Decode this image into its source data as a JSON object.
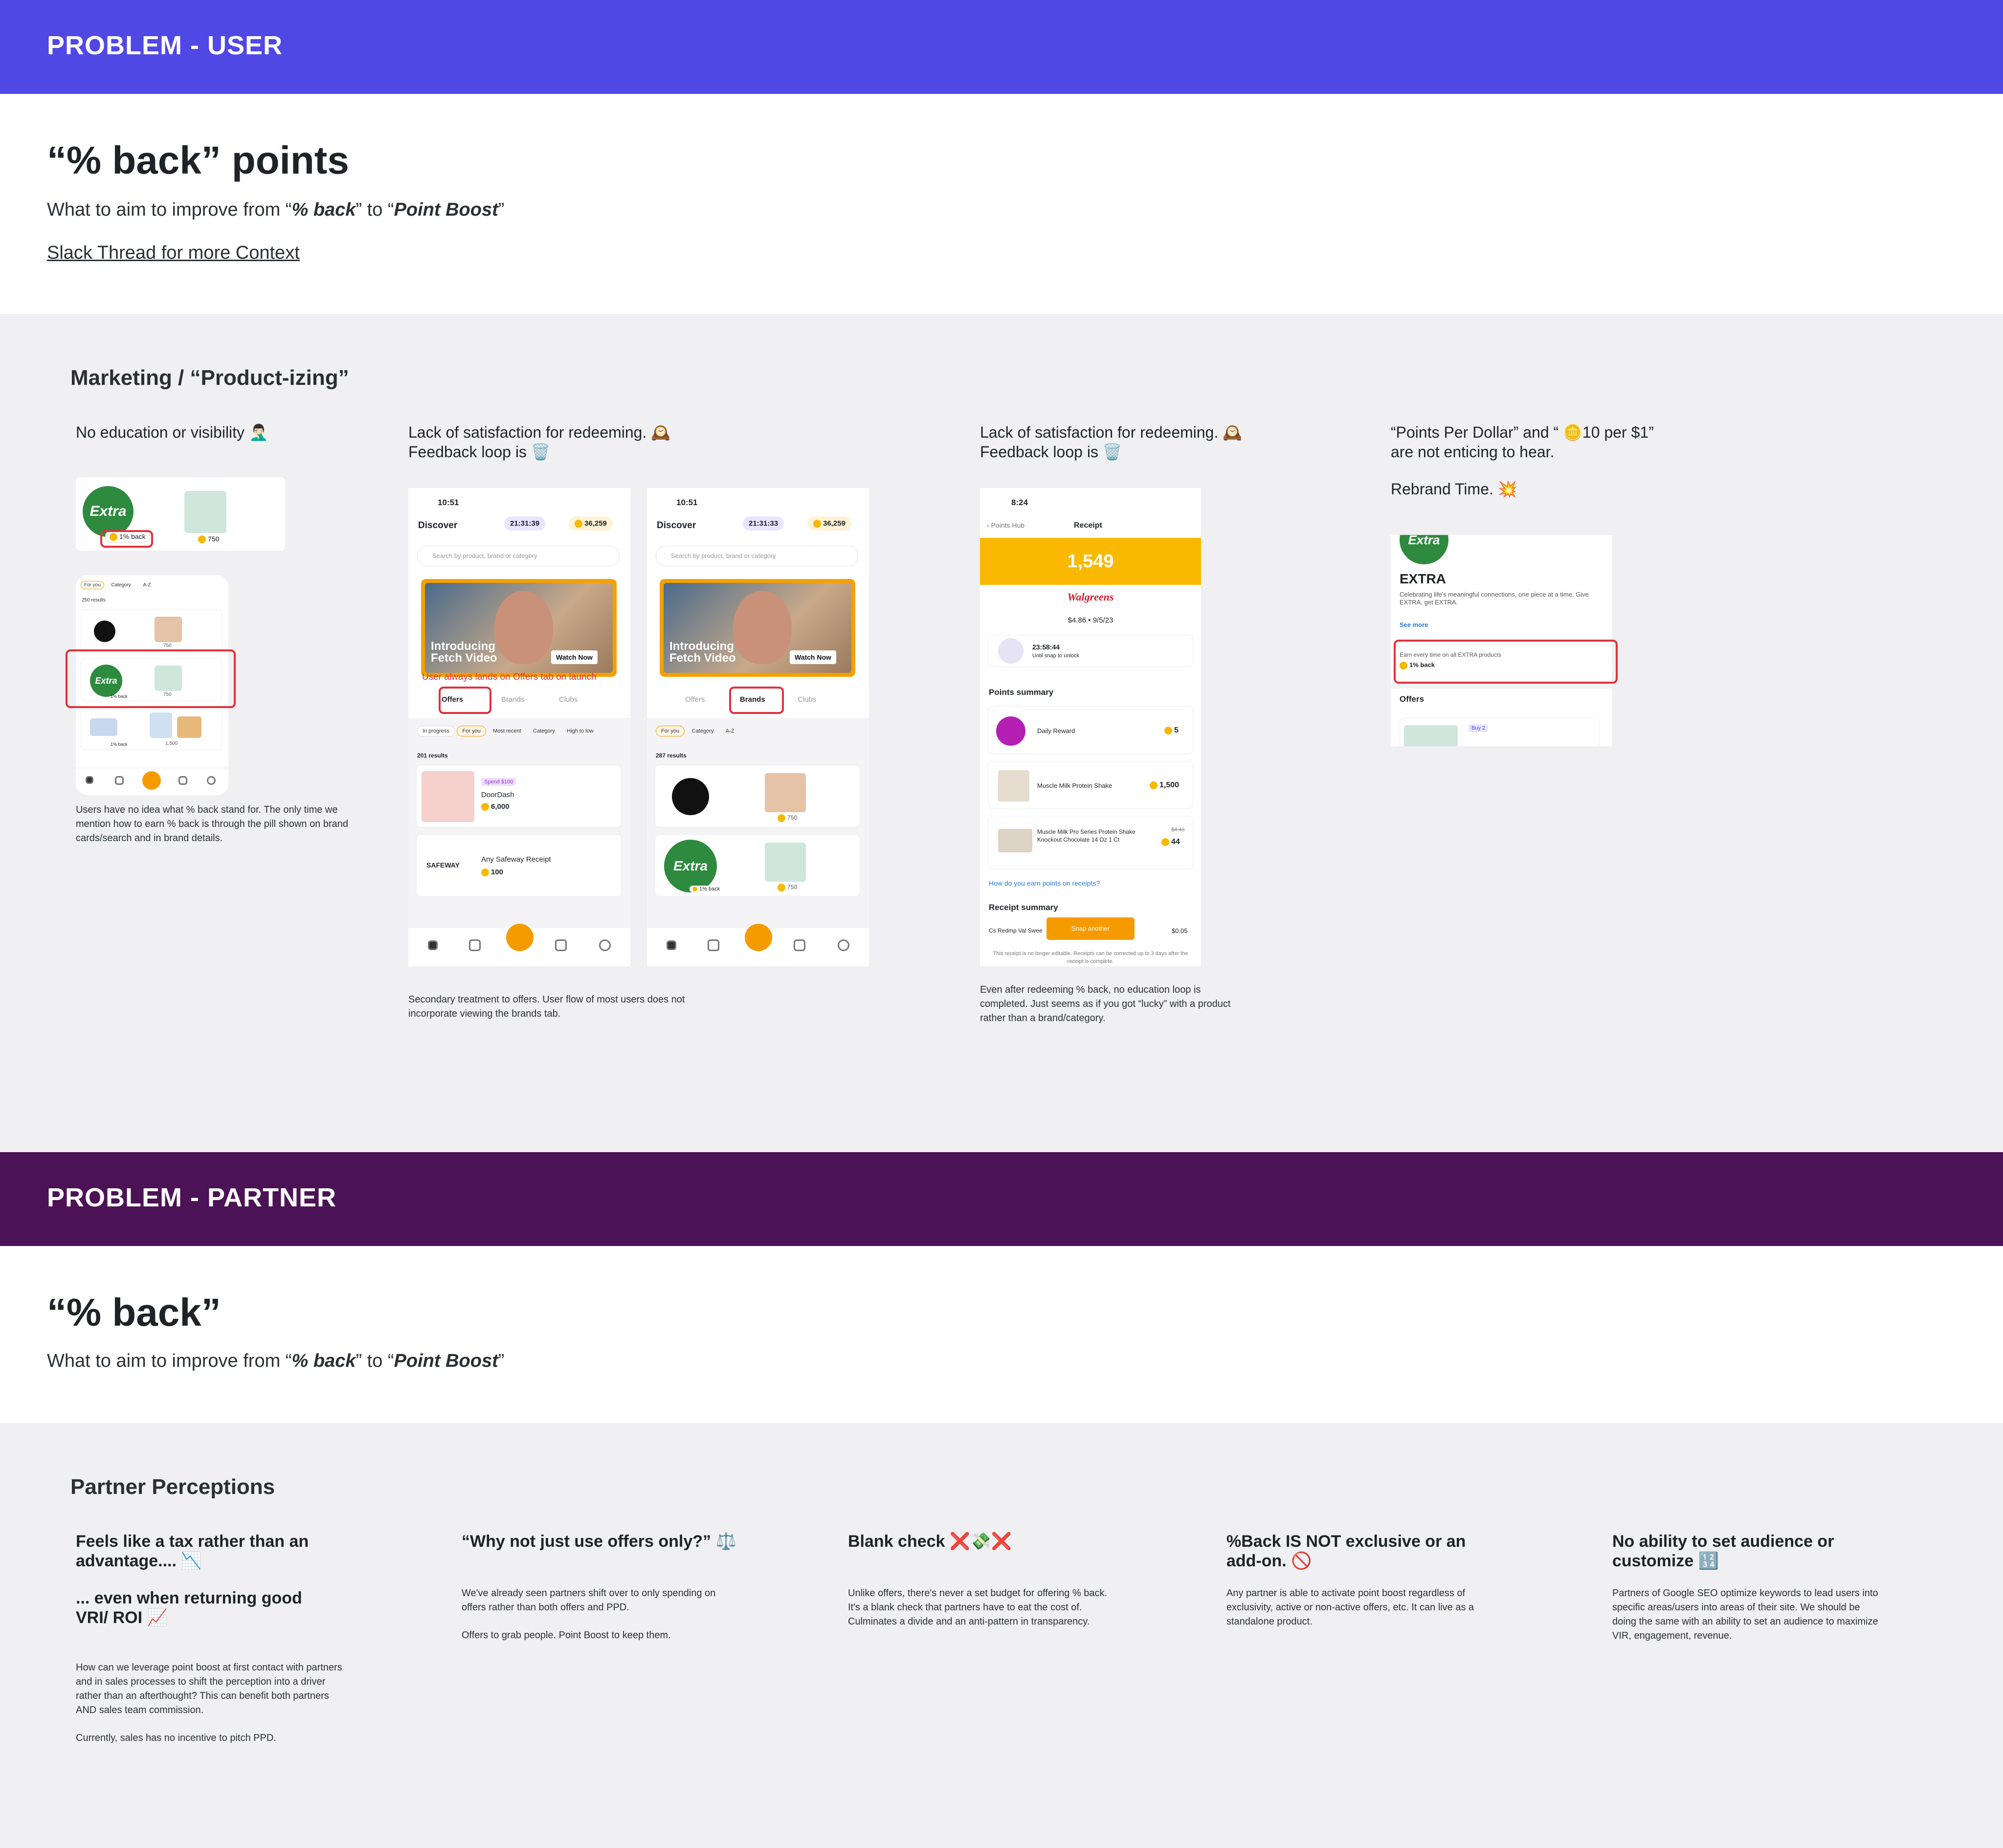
{
  "user_section": {
    "band_title": "PROBLEM - USER",
    "band_color": "#5048e5",
    "heading": "“% back” points",
    "subtitle_prefix": "What to aim to improve from “",
    "subtitle_em1": "% back",
    "subtitle_mid": "” to “",
    "subtitle_em2": "Point Boost",
    "subtitle_suffix": "”",
    "link": "Slack Thread for more Context"
  },
  "marketing": {
    "title": "Marketing / “Product-izing”",
    "col1": {
      "title": "No education or visibility 🤦🏻‍♂️",
      "note": "Users have no idea what % back stand for. The only time we mention how to earn % back is through the pill shown on brand cards/search and in brand details.",
      "card_pill": "1% back",
      "card_points": "750",
      "tabs": [
        "For you",
        "Category",
        "A-Z"
      ],
      "results": "250 results",
      "rows": [
        {
          "points": "750"
        },
        {
          "points": "750",
          "pill": "1% back"
        },
        {
          "points": "1,500",
          "pill": "1% back"
        }
      ]
    },
    "col2": {
      "title_line1": "Lack of satisfaction for redeeming. 🕰️",
      "title_line2": "Feedback loop is 🗑️",
      "note": "Secondary treatment to offers. User flow of most users does not incorporate viewing the brands tab.",
      "annotation": "User always lands on Offers tab on launch",
      "phone_a": {
        "time": "10:51",
        "title": "Discover",
        "timer": "21:31:39",
        "points": "36,259",
        "search_placeholder": "Search by product, brand or category",
        "video_title_1": "Introducing",
        "video_title_2": "Fetch Video",
        "watch": "Watch Now",
        "tabs": [
          "Offers",
          "Brands",
          "Clubs"
        ],
        "filters": [
          "In progress",
          "For you",
          "Most recent",
          "Category",
          "High to low"
        ],
        "results": "201 results",
        "offers": [
          {
            "badge": "Spend $100",
            "name": "DoorDash",
            "points": "6,000"
          },
          {
            "logo": "SAFEWAY",
            "name": "Any Safeway Receipt",
            "points": "100"
          }
        ]
      },
      "phone_b": {
        "time": "10:51",
        "title": "Discover",
        "timer": "21:31:33",
        "points": "36,259",
        "search_placeholder": "Search by product, brand or category",
        "video_title_1": "Introducing",
        "video_title_2": "Fetch Video",
        "watch": "Watch Now",
        "tabs": [
          "Offers",
          "Brands",
          "Clubs"
        ],
        "filters": [
          "For you",
          "Category",
          "A-Z"
        ],
        "results": "287 results",
        "rows": [
          {
            "points": "750"
          },
          {
            "points": "750",
            "pill": "1% back"
          }
        ]
      }
    },
    "col3": {
      "title_line1": "Lack of satisfaction for redeeming. 🕰️",
      "title_line2": "Feedback loop is 🗑️",
      "note": "Even after redeeming % back, no education loop is completed. Just seems as if you got “lucky” with a product rather than a brand/category.",
      "phone": {
        "time": "8:24",
        "back": "Points Hub",
        "title": "Receipt",
        "points": "1,549",
        "store": "Walgreens",
        "meta": "$4.86 • 9/5/23",
        "timer": "23:58:44",
        "timer_sub": "Until snap to unlock",
        "summary_title": "Points summary",
        "items": [
          {
            "name": "Daily Reward",
            "points": "5"
          },
          {
            "name": "Muscle Milk Protein Shake",
            "points": "1,500"
          },
          {
            "name": "Muscle Milk Pro Series Protein Shake Knockout Chocolate 14 Oz 1 Ct",
            "strike": "$4.43",
            "points": "44"
          }
        ],
        "how_link": "How do you earn points on receipts?",
        "receipt_title": "Receipt summary",
        "receipt_line": "Cs Redmp Val Swee",
        "receipt_amount": "$0.05",
        "snap_button": "Snap another",
        "footer": "This receipt is no longer editable. Receipts can be corrected up to 3 days after the receipt is complete."
      }
    },
    "col4": {
      "title_line1": "“Points Per Dollar” and “ 🪙10 per $1”",
      "title_line2": "are not enticing to hear.",
      "title_line3": "Rebrand Time. 💥",
      "brand": {
        "name": "EXTRA",
        "desc": "Celebrating life's meaningful connections, one piece at a time. Give EXTRA, get EXTRA.",
        "see_more": "See more",
        "earn_text": "Earn every time on all EXTRA products",
        "earn_pill": "1% back",
        "offers_title": "Offers",
        "offer_badge": "Buy 2"
      }
    }
  },
  "partner_section": {
    "band_title": "PROBLEM - PARTNER",
    "band_color": "#4b1255",
    "heading": "“% back”",
    "subtitle_prefix": "What to aim to improve from “",
    "subtitle_em1": "% back",
    "subtitle_mid": "” to “",
    "subtitle_em2": "Point Boost",
    "subtitle_suffix": "”"
  },
  "perceptions": {
    "title": "Partner Perceptions",
    "cols": [
      {
        "title": "Feels like a tax rather than an advantage.... 📉",
        "title2": "... even when returning good VRI/ ROI 📈",
        "note": "How can we leverage point boost at first contact with partners and in sales processes to shift the perception into a driver rather than an afterthought? This can benefit both partners AND sales team commission.",
        "note2": "Currently, sales has no incentive to pitch PPD."
      },
      {
        "title": "“Why not just use offers only?” ⚖️",
        "note": "We've already seen partners shift over to only spending on offers rather than both offers and PPD.",
        "note2": "Offers to grab people. Point Boost to keep them."
      },
      {
        "title": "Blank check ❌💸❌",
        "note": "Unlike offers, there's never a set budget for offering % back. It's a blank check that partners have to eat the cost of. Culminates a divide and an anti-pattern in transparency."
      },
      {
        "title": "%Back IS NOT exclusive or an add-on. 🚫",
        "note": "Any partner is able to activate point boost regardless of exclusivity, active or non-active offers, etc. It can live as a standalone product."
      },
      {
        "title": "No ability to set audience or customize 🔢",
        "note": "Partners of Google SEO optimize keywords to lead users into specific areas/users into areas of their site. We should be doing the same with an ability to set an audience to maximize VIR, engagement, revenue."
      }
    ]
  },
  "colors": {
    "gray_bg": "#f0f0f2",
    "highlight_red": "#e2303d",
    "fetch_orange": "#f59b00",
    "receipt_yellow": "#fbb800"
  }
}
